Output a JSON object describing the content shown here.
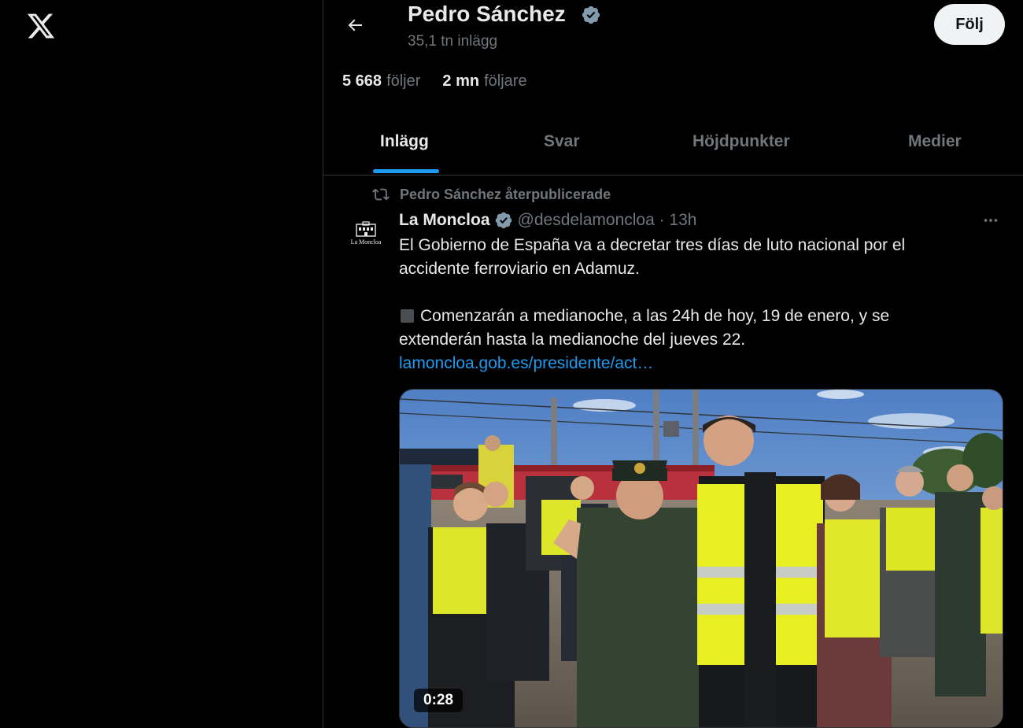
{
  "app": {
    "logo_icon": "x-logo-icon"
  },
  "profile": {
    "name": "Pedro Sánchez",
    "posts_count": "35,1 tn inlägg",
    "follow_label": "Följ",
    "following_num": "5 668",
    "following_label": "följer",
    "followers_num": "2 mn",
    "followers_label": "följare"
  },
  "tabs": [
    {
      "label": "Inlägg",
      "active": true
    },
    {
      "label": "Svar",
      "active": false
    },
    {
      "label": "Höjdpunkter",
      "active": false
    },
    {
      "label": "Medier",
      "active": false
    }
  ],
  "post": {
    "repost_label": "Pedro Sánchez återpublicerade",
    "avatar_text": "La Moncloa",
    "author_name": "La Moncloa",
    "author_meta": "@desdelamoncloa · 13h",
    "text_line1": "El Gobierno de España va a decretar tres días de luto nacional por el",
    "text_line2": "accidente ferroviario en Adamuz.",
    "text_line3": "Comenzarán a medianoche, a las 24h de hoy, 19 de enero, y se",
    "text_line4": "extenderán hasta la medianoche del jueves 22.",
    "link": "lamoncloa.gob.es/presidente/act…",
    "video_duration": "0:28"
  },
  "colors": {
    "background": "#000000",
    "accent": "#1d9bf0",
    "text_primary": "#e7e9ea",
    "text_secondary": "#71767b",
    "border": "#2f3336"
  }
}
